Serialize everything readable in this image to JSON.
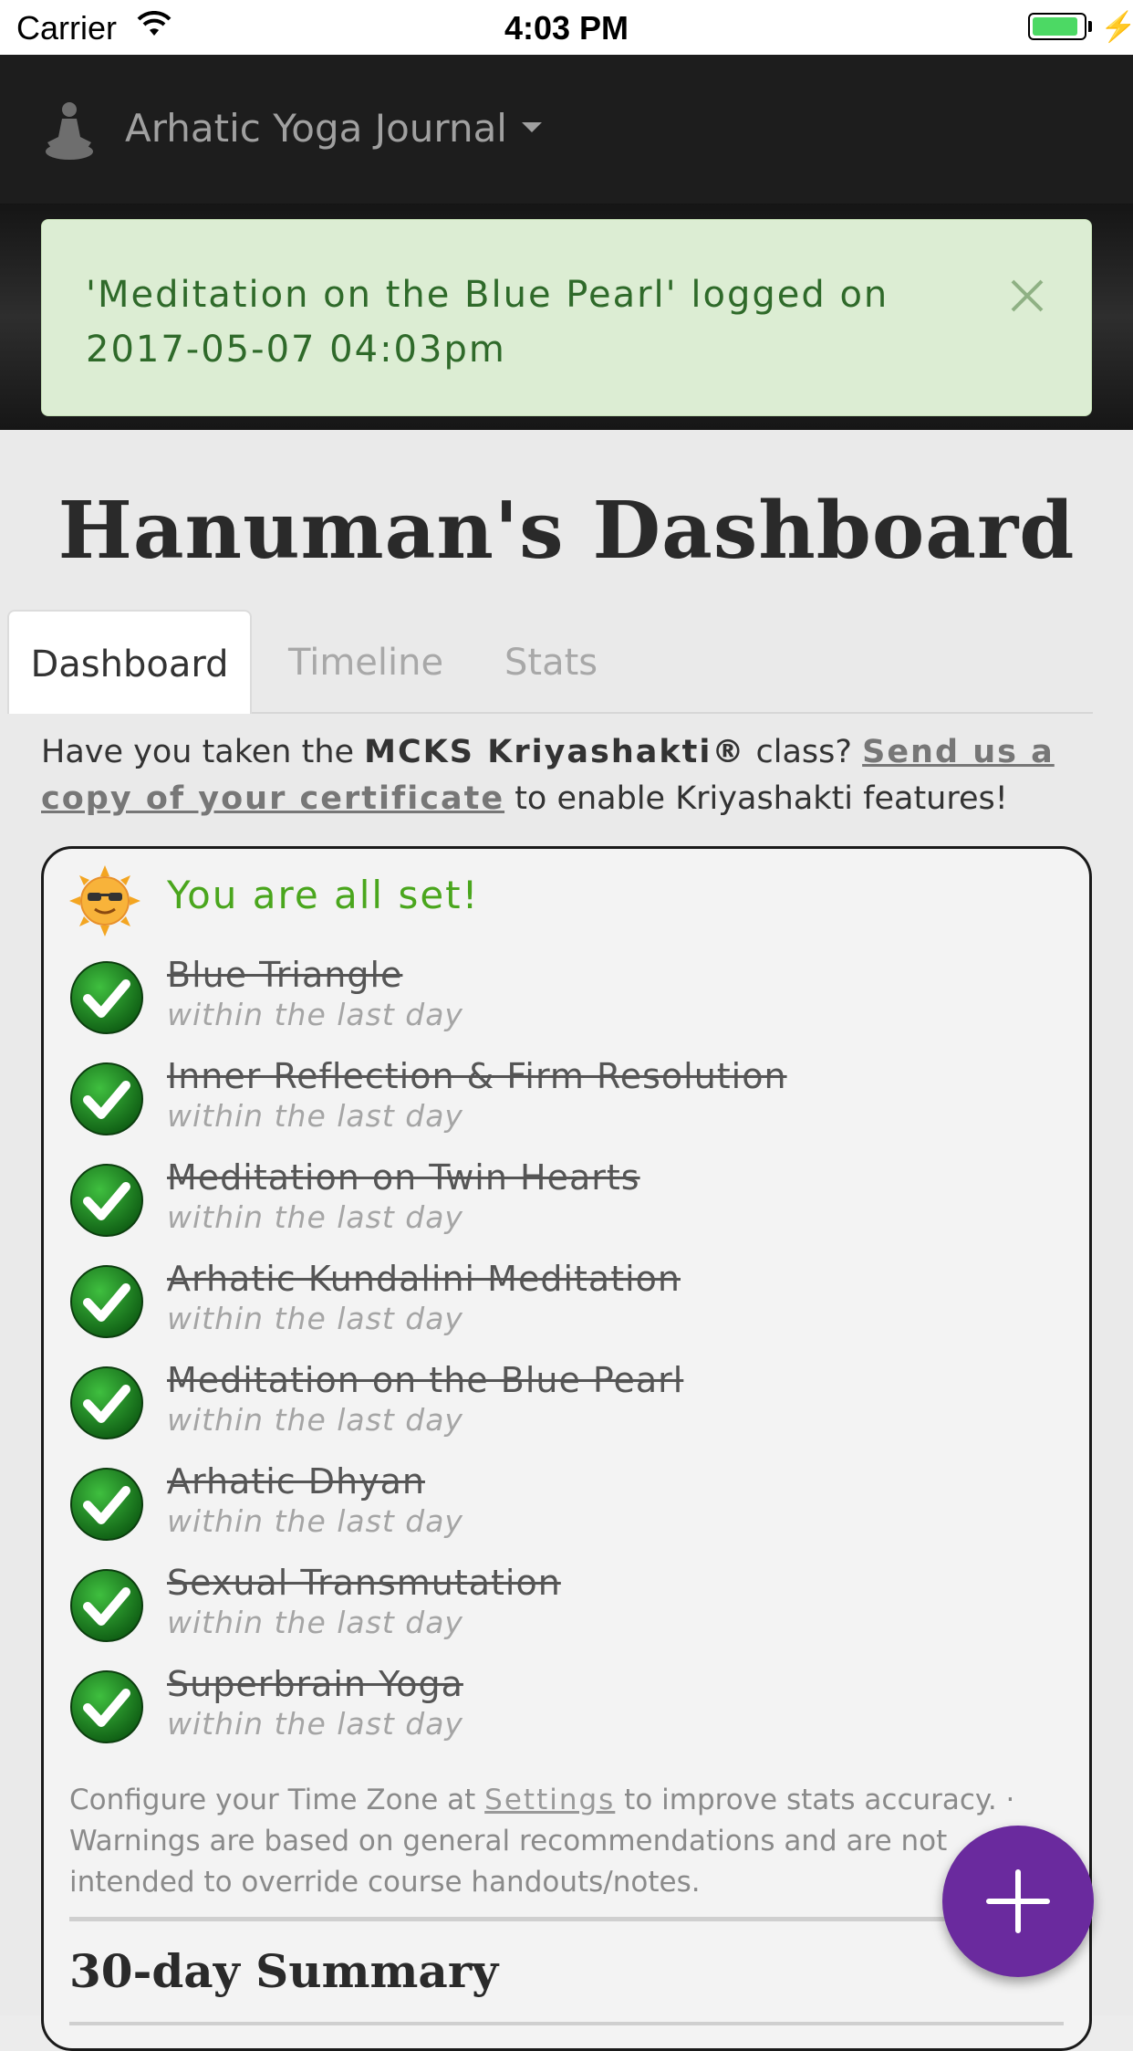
{
  "status_bar": {
    "carrier": "Carrier",
    "time": "4:03 PM",
    "battery_level": 0.9
  },
  "navbar": {
    "brand": "Arhatic Yoga Journal",
    "logo_icon": "meditating-figure-icon"
  },
  "alert": {
    "message": "'Meditation on the Blue Pearl' logged on 2017-05-07 04:03pm",
    "color": "#dcedd3"
  },
  "page": {
    "title": "Hanuman's Dashboard"
  },
  "tabs": [
    {
      "label": "Dashboard",
      "active": true
    },
    {
      "label": "Timeline",
      "active": false
    },
    {
      "label": "Stats",
      "active": false
    }
  ],
  "notice": {
    "prefix": "Have you taken the ",
    "class_name": "MCKS Kriyashakti®",
    "middle": " class? ",
    "link": "Send us a copy of your certificate",
    "suffix": " to enable Kriyashakti features!"
  },
  "panel": {
    "status": "You are all set!",
    "status_icon": "sun-with-sunglasses-icon",
    "items": [
      {
        "title": "Blue Triangle",
        "subtitle": "within the last day"
      },
      {
        "title": "Inner Reflection & Firm Resolution",
        "subtitle": "within the last day"
      },
      {
        "title": "Meditation on Twin Hearts",
        "subtitle": "within the last day"
      },
      {
        "title": "Arhatic Kundalini Meditation",
        "subtitle": "within the last day"
      },
      {
        "title": "Meditation on the Blue Pearl",
        "subtitle": "within the last day"
      },
      {
        "title": "Arhatic Dhyan",
        "subtitle": "within the last day"
      },
      {
        "title": "Sexual Transmutation",
        "subtitle": "within the last day"
      },
      {
        "title": "Superbrain Yoga",
        "subtitle": "within the last day"
      }
    ],
    "footnote": {
      "prefix": "Configure your Time Zone at ",
      "link": "Settings",
      "suffix": " to improve stats accuracy. · Warnings are based on general recommendations and are not intended to override course handouts/notes."
    },
    "summary_title": "30-day Summary"
  },
  "fab": {
    "icon": "plus-icon",
    "color": "#6a2a9e"
  }
}
